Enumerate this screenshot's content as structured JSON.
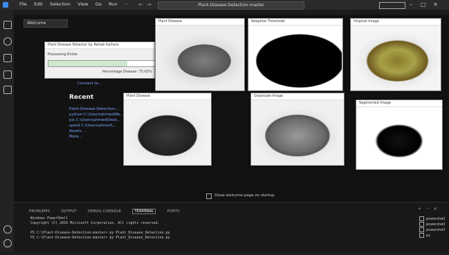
{
  "titlebar": {
    "menu": [
      "File",
      "Edit",
      "Selection",
      "View",
      "Go",
      "Run",
      "···"
    ],
    "command_center": "Plant-Disease-Detection-master"
  },
  "editor": {
    "tab_label": "Welcome",
    "recent_title": "Recent",
    "recent_items": [
      "Plant-Disease-Detection-...",
      "python  C:\\Users\\ahmed\\Re...",
      "pix  C:\\Users\\ahmed\\Desk...",
      "sperd  C:\\Users\\ahmed\\...",
      "Assets ...",
      "More..."
    ],
    "link_text": "Connect to...",
    "startup_label": "Show welcome page on startup"
  },
  "dialog": {
    "title": "Plant Disease Detector by Rehab Kalhoro",
    "processing_label": "Processing Entire",
    "progress_label": "Percentage Disease: 75.63%",
    "progress": 0.5
  },
  "image_windows": [
    {
      "title": "Plant Disease"
    },
    {
      "title": "Adaptive Threshold"
    },
    {
      "title": "Original Image"
    },
    {
      "title": "Plant Disease"
    },
    {
      "title": "Grayscale Image"
    },
    {
      "title": "Segmented Image"
    }
  ],
  "panel": {
    "tabs": [
      "PROBLEMS",
      "OUTPUT",
      "DEBUG CONSOLE",
      "TERMINAL",
      "PORTS"
    ],
    "active_tab": "TERMINAL",
    "terminal_lines": [
      "Windows PowerShell",
      "Copyright (C) 2016 Microsoft Corporation. All rights reserved.",
      "",
      "PS C:\\Plant-Disease-Detection-master> py Plant_Disease_Detection.py",
      "PS C:\\Plant-Disease-Detection-master> py Plant_Disease_Detection.py"
    ],
    "sessions": [
      "powershell",
      "powershell",
      "powershell",
      "py"
    ]
  }
}
